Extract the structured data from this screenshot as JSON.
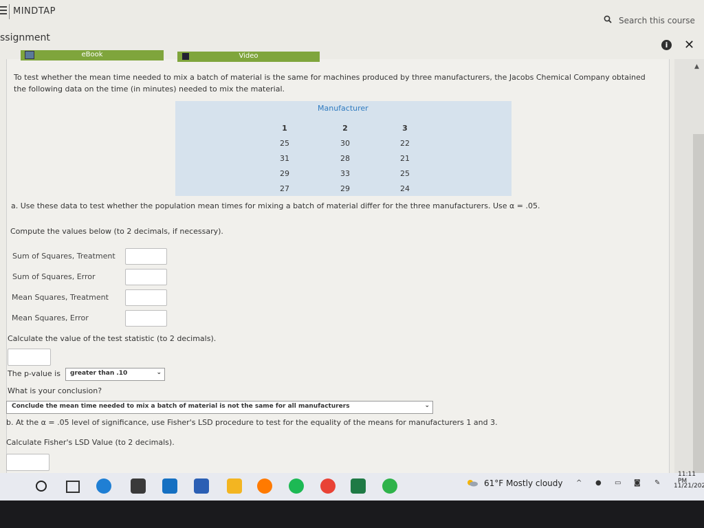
{
  "header": {
    "brand": "MINDTAP",
    "search_placeholder": "Search this course",
    "assignment_title": "ssignment"
  },
  "tabs": {
    "ebook": "eBook",
    "video": "Video"
  },
  "intro": "To test whether the mean time needed to mix a batch of material is the same for machines produced by three manufacturers, the Jacobs Chemical Company obtained the following data on the time (in minutes) needed to mix the material.",
  "table": {
    "title": "Manufacturer",
    "headers": [
      "1",
      "2",
      "3"
    ],
    "rows": [
      [
        "25",
        "30",
        "22"
      ],
      [
        "31",
        "28",
        "21"
      ],
      [
        "29",
        "33",
        "25"
      ],
      [
        "27",
        "29",
        "24"
      ]
    ]
  },
  "question_a": "a. Use these data to test whether the population mean times for mixing a batch of material differ for the three manufacturers. Use α = .05.",
  "compute_label": "Compute the values below (to 2 decimals, if necessary).",
  "fields": [
    {
      "label": "Sum of Squares, Treatment",
      "value": ""
    },
    {
      "label": "Sum of Squares, Error",
      "value": ""
    },
    {
      "label": "Mean Squares, Treatment",
      "value": ""
    },
    {
      "label": "Mean Squares, Error",
      "value": ""
    }
  ],
  "test_statistic_label": "Calculate the value of the test statistic (to 2 decimals).",
  "pvalue": {
    "label": "The p-value is",
    "selected": "greater than .10"
  },
  "conclusion": {
    "label": "What is your conclusion?",
    "selected": "Conclude the mean time needed to mix a batch of material is not the same for all manufacturers"
  },
  "question_b": "b. At the α = .05 level of significance, use Fisher's LSD procedure to test for the equality of the means for manufacturers 1 and 3.",
  "lsd_label": "Calculate Fisher's LSD Value (to 2 decimals).",
  "taskbar": {
    "weather": "61°F  Mostly cloudy",
    "time": "11:11 PM",
    "date": "11/21/202",
    "colors": {
      "edge": "#1f7fd4",
      "store": "#3a3a3a",
      "mail": "#1570c2",
      "word": "#2b5fb4",
      "files": "#f3b521",
      "brave": "#ff7a00",
      "spotify": "#1db954",
      "chrome": "#e94235",
      "excel": "#1f7a45",
      "chat": "#2fb34a"
    }
  }
}
